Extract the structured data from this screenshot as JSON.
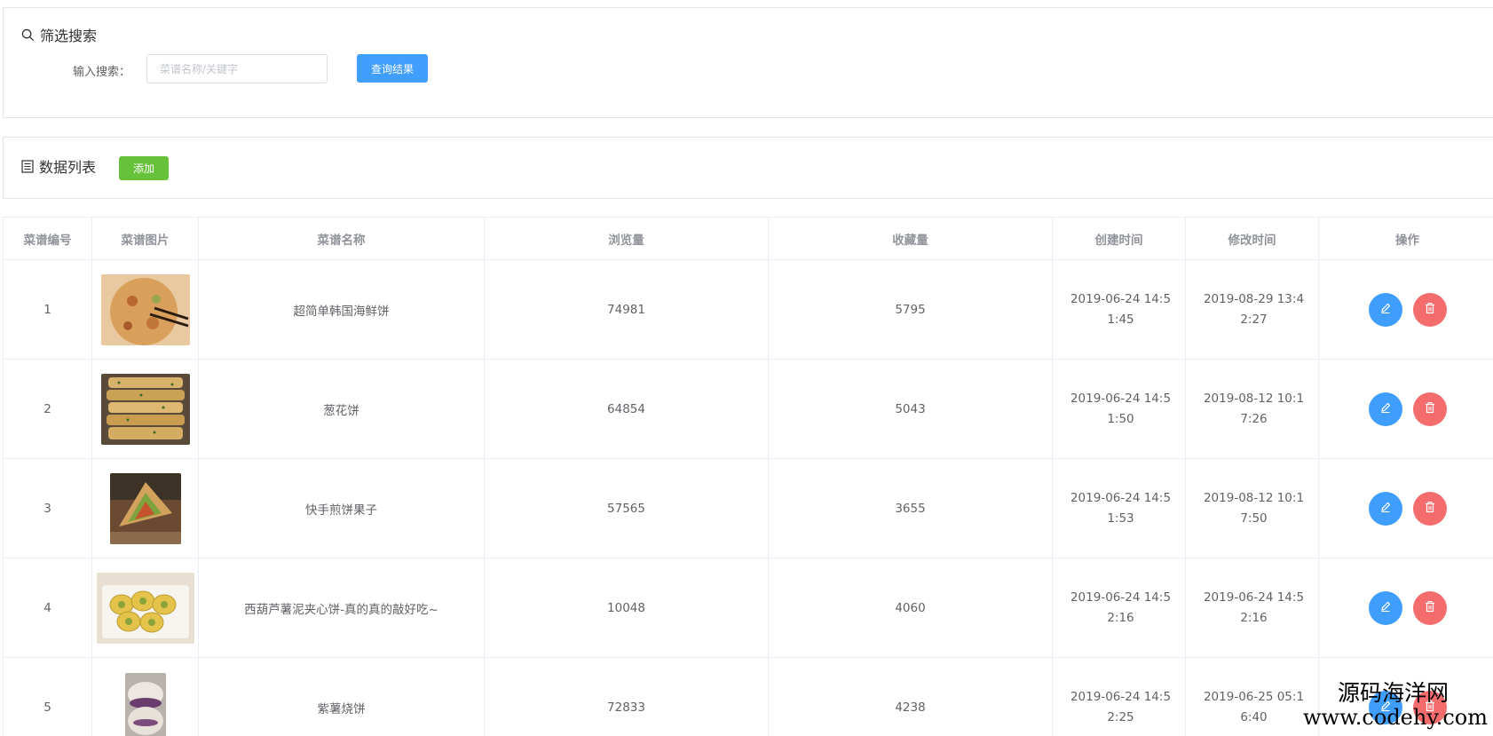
{
  "search_panel": {
    "title": "筛选搜索",
    "label": "输入搜索：",
    "placeholder": "菜谱名称/关键字",
    "query_button": "查询结果"
  },
  "list_panel": {
    "title": "数据列表",
    "add_button": "添加"
  },
  "table": {
    "headers": [
      "菜谱编号",
      "菜谱图片",
      "菜谱名称",
      "浏览量",
      "收藏量",
      "创建时间",
      "修改时间",
      "操作"
    ],
    "rows": [
      {
        "id": "1",
        "name": "超简单韩国海鲜饼",
        "views": "74981",
        "favorites": "5795",
        "created": "2019-06-24 14:51:45",
        "modified": "2019-08-29 13:42:27"
      },
      {
        "id": "2",
        "name": "葱花饼",
        "views": "64854",
        "favorites": "5043",
        "created": "2019-06-24 14:51:50",
        "modified": "2019-08-12 10:17:26"
      },
      {
        "id": "3",
        "name": "快手煎饼果子",
        "views": "57565",
        "favorites": "3655",
        "created": "2019-06-24 14:51:53",
        "modified": "2019-08-12 10:17:50"
      },
      {
        "id": "4",
        "name": "西葫芦薯泥夹心饼-真的真的敲好吃~",
        "views": "10048",
        "favorites": "4060",
        "created": "2019-06-24 14:52:16",
        "modified": "2019-06-24 14:52:16"
      },
      {
        "id": "5",
        "name": "紫薯烧饼",
        "views": "72833",
        "favorites": "4238",
        "created": "2019-06-24 14:52:25",
        "modified": "2019-06-25 05:16:40"
      }
    ]
  },
  "icons": {
    "search": "search-icon",
    "list": "list-icon",
    "edit": "edit-icon",
    "delete": "delete-icon"
  },
  "colors": {
    "primary": "#409eff",
    "success": "#67c23a",
    "danger": "#f56c6c"
  },
  "watermark": {
    "line1": "源码海洋网",
    "line2": "www.codehy.com"
  }
}
